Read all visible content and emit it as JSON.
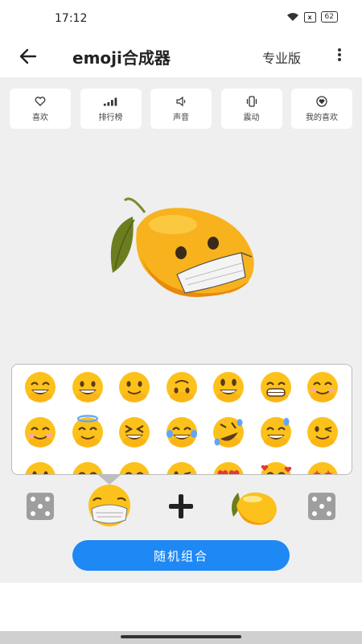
{
  "status": {
    "time": "17:12",
    "battery": "62"
  },
  "app_bar": {
    "title": "emoji合成器",
    "pro_label": "专业版"
  },
  "toolbar": [
    {
      "label": "喜欢",
      "icon": "heart-outline-icon"
    },
    {
      "label": "排行榜",
      "icon": "signal-bars-icon"
    },
    {
      "label": "声音",
      "icon": "speaker-icon"
    },
    {
      "label": "震动",
      "icon": "vibrate-icon"
    },
    {
      "label": "我的喜欢",
      "icon": "heart-filled-icon"
    }
  ],
  "result_emoji": {
    "name": "lemon-with-medical-mask",
    "color": "#f7b21e"
  },
  "picker": {
    "emojis": [
      [
        "grinning-smiling-eyes",
        "grinning",
        "slightly-smiling",
        "upside-down",
        "grinning-big-eyes",
        "grimacing",
        "smiling-eyes"
      ],
      [
        "relaxed",
        "halo",
        "squinting-laughing",
        "joy-tears",
        "rolling-laughing",
        "sweat-smile",
        "winking"
      ],
      [
        "kissing",
        "kissing-closed-eyes",
        "kissing-smiling-eyes",
        "kissing-heart",
        "heart-eyes",
        "smiling-hearts",
        "star-struck"
      ]
    ]
  },
  "combo": {
    "left_emoji": "face-with-medical-mask",
    "right_emoji": "lemon"
  },
  "random_button": {
    "label": "随机组合"
  },
  "colors": {
    "accent": "#1e88f5",
    "emoji_yellow": "#fcc21b",
    "emoji_orange": "#f59e0b",
    "background": "#efefef"
  }
}
